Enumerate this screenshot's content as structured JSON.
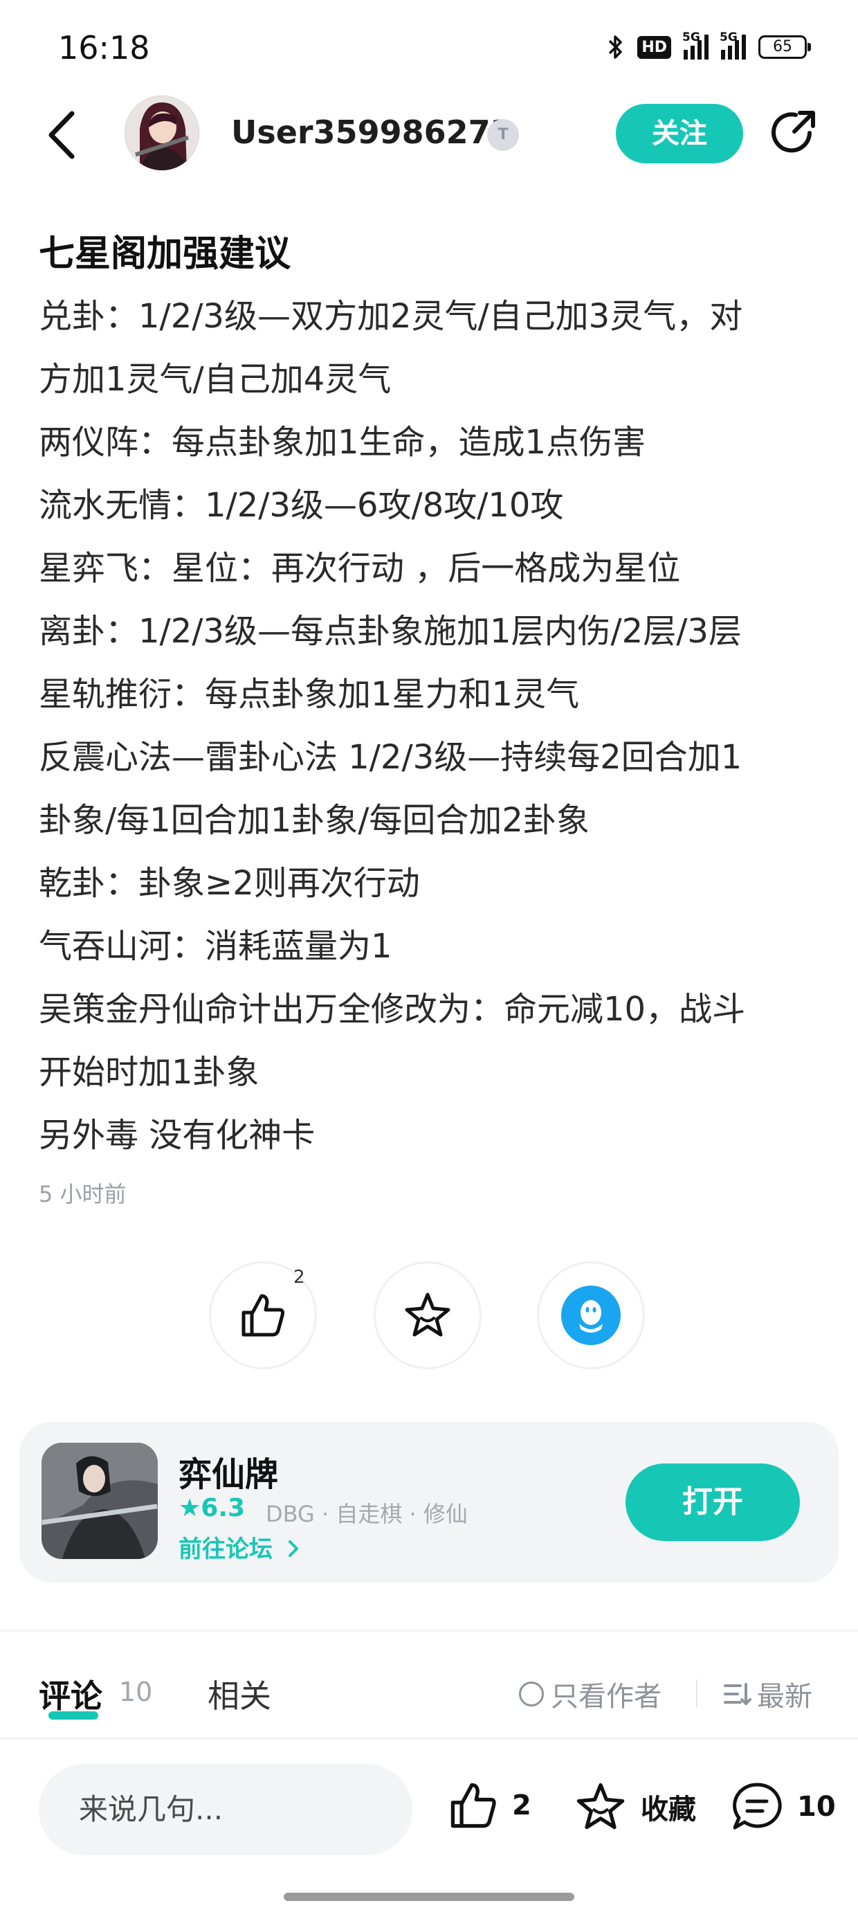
{
  "status_bar": {
    "time": "16:18",
    "battery": "65",
    "network_1": "5G",
    "network_2": "5G",
    "hd_label": "HD"
  },
  "header": {
    "username": "User359986273",
    "badge": "T",
    "follow_label": "关注",
    "icons": [
      "back-arrow-icon",
      "share-icon"
    ]
  },
  "post": {
    "title": "七星阁加强建议",
    "lines": [
      "兑卦：1/2/3级—双方加2灵气/自己加3灵气，对",
      "方加1灵气/自己加4灵气",
      "两仪阵：每点卦象加1生命，造成1点伤害",
      "流水无情：1/2/3级—6攻/8攻/10攻",
      "星弈飞：星位：再次行动 ，后一格成为星位",
      "离卦：1/2/3级—每点卦象施加1层内伤/2层/3层",
      "星轨推衍：每点卦象加1星力和1灵气",
      "反震心法—雷卦心法 1/2/3级—持续每2回合加1",
      "卦象/每1回合加1卦象/每回合加2卦象",
      "乾卦：卦象≥2则再次行动",
      "气吞山河：消耗蓝量为1",
      "吴策金丹仙命计出万全修改为：命元减10，战斗",
      "开始时加1卦象",
      "另外毒 没有化神卡"
    ],
    "time": "5 小时前"
  },
  "reactions": {
    "like_count": "2"
  },
  "game_card": {
    "name": "弈仙牌",
    "rating": "6.3",
    "tags": "DBG · 自走棋 · 修仙",
    "forum_link": "前往论坛",
    "open_label": "打开"
  },
  "tabs": {
    "comments_label": "评论",
    "comments_count": "10",
    "related_label": "相关",
    "author_only_label": "只看作者",
    "sort_label": "最新"
  },
  "bottom_bar": {
    "input_placeholder": "来说几句...",
    "like_count": "2",
    "favorite_label": "收藏",
    "comment_count": "10"
  },
  "colors": {
    "accent": "#17c7b6",
    "qq_blue": "#1aa5f0"
  }
}
